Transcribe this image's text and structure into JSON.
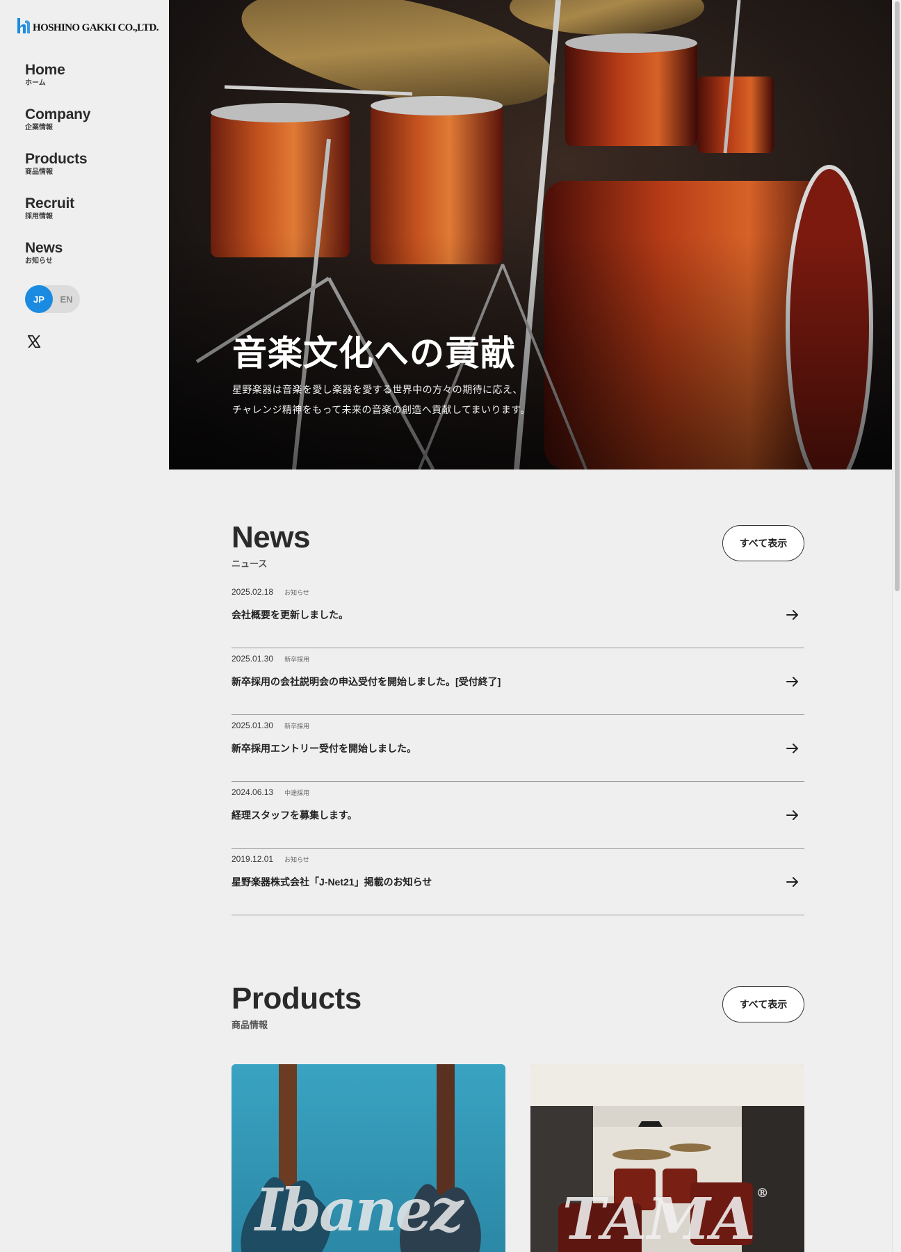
{
  "logo": {
    "text": "HOSHINO GAKKI CO.,LTD."
  },
  "nav": [
    {
      "en": "Home",
      "jp": "ホーム"
    },
    {
      "en": "Company",
      "jp": "企業情報"
    },
    {
      "en": "Products",
      "jp": "商品情報"
    },
    {
      "en": "Recruit",
      "jp": "採用情報"
    },
    {
      "en": "News",
      "jp": "お知らせ"
    }
  ],
  "lang": {
    "active": "JP",
    "inactive": "EN"
  },
  "social": {
    "icon": "x-icon"
  },
  "hero": {
    "title": "音楽文化への貢献",
    "line1": "星野楽器は音楽を愛し楽器を愛する世界中の方々の期待に応え、",
    "line2": "チャレンジ精神をもって未来の音楽の創造へ貢献してまいります。"
  },
  "news": {
    "title": "News",
    "subtitle": "ニュース",
    "view_all": "すべて表示",
    "items": [
      {
        "date": "2025.02.18",
        "category": "お知らせ",
        "title": "会社概要を更新しました。"
      },
      {
        "date": "2025.01.30",
        "category": "新卒採用",
        "title": "新卒採用の会社説明会の申込受付を開始しました。[受付終了]"
      },
      {
        "date": "2025.01.30",
        "category": "新卒採用",
        "title": "新卒採用エントリー受付を開始しました。"
      },
      {
        "date": "2024.06.13",
        "category": "中途採用",
        "title": "経理スタッフを募集します。"
      },
      {
        "date": "2019.12.01",
        "category": "お知らせ",
        "title": "星野楽器株式会社「J-Net21」掲載のお知らせ"
      }
    ]
  },
  "products": {
    "title": "Products",
    "subtitle": "商品情報",
    "view_all": "すべて表示",
    "cards": [
      {
        "brand": "Ibanez"
      },
      {
        "brand": "TAMA",
        "mark": "®"
      }
    ]
  },
  "colors": {
    "accent": "#1a8be0",
    "background": "#efefef"
  }
}
